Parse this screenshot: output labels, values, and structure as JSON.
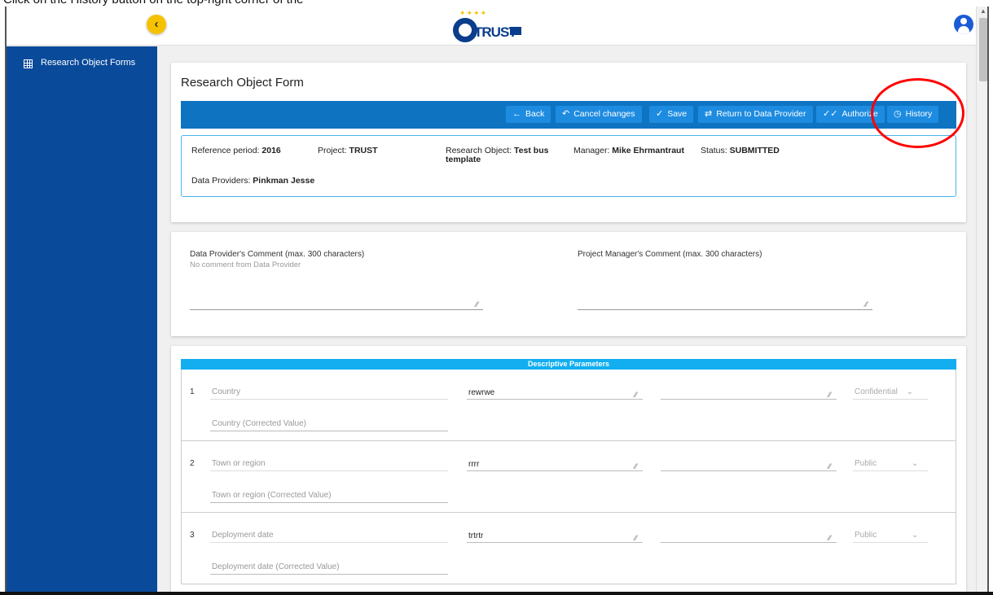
{
  "caption": "Click on the History button on the top-right corner of the",
  "header": {
    "logo_text": "TRUST",
    "toggle_icon": "chevron-left-icon",
    "avatar_icon": "user-avatar-icon"
  },
  "sidebar": {
    "items": [
      {
        "label": "Research Object Forms",
        "icon": "grid-icon"
      }
    ]
  },
  "form": {
    "title": "Research Object Form",
    "toolbar": {
      "back": "Back",
      "cancel": "Cancel changes",
      "save": "Save",
      "return": "Return to Data Provider",
      "authorize": "Authorize",
      "history": "History"
    },
    "info": {
      "reference_period_label": "Reference period:",
      "reference_period": "2016",
      "project_label": "Project:",
      "project": "TRUST",
      "research_object_label": "Research Object:",
      "research_object": "Test bus template",
      "manager_label": "Manager:",
      "manager": "Mike Ehrmantraut",
      "status_label": "Status:",
      "status": "SUBMITTED",
      "data_providers_label": "Data Providers:",
      "data_providers": "Pinkman Jesse"
    }
  },
  "comments": {
    "provider_label": "Data Provider's Comment (max. 300 characters)",
    "provider_sub": "No comment from Data Provider",
    "manager_label": "Project Manager's Comment (max. 300 characters)"
  },
  "params": {
    "header": "Descriptive Parameters",
    "rows": [
      {
        "num": "1",
        "name": "Country",
        "value": "rewrwe",
        "visibility": "Confidential",
        "corrected": "Country (Corrected Value)"
      },
      {
        "num": "2",
        "name": "Town or region",
        "value": "rrrr",
        "visibility": "Public",
        "corrected": "Town or region (Corrected Value)"
      },
      {
        "num": "3",
        "name": "Deployment date",
        "value": "trtrtr",
        "visibility": "Public",
        "corrected": "Deployment date (Corrected Value)"
      }
    ]
  },
  "colors": {
    "sidebar": "#0a4a9a",
    "toolbar": "#0e74c2",
    "accent": "#12aef0",
    "highlight": "#ff0000",
    "toggle": "#f6c200"
  }
}
